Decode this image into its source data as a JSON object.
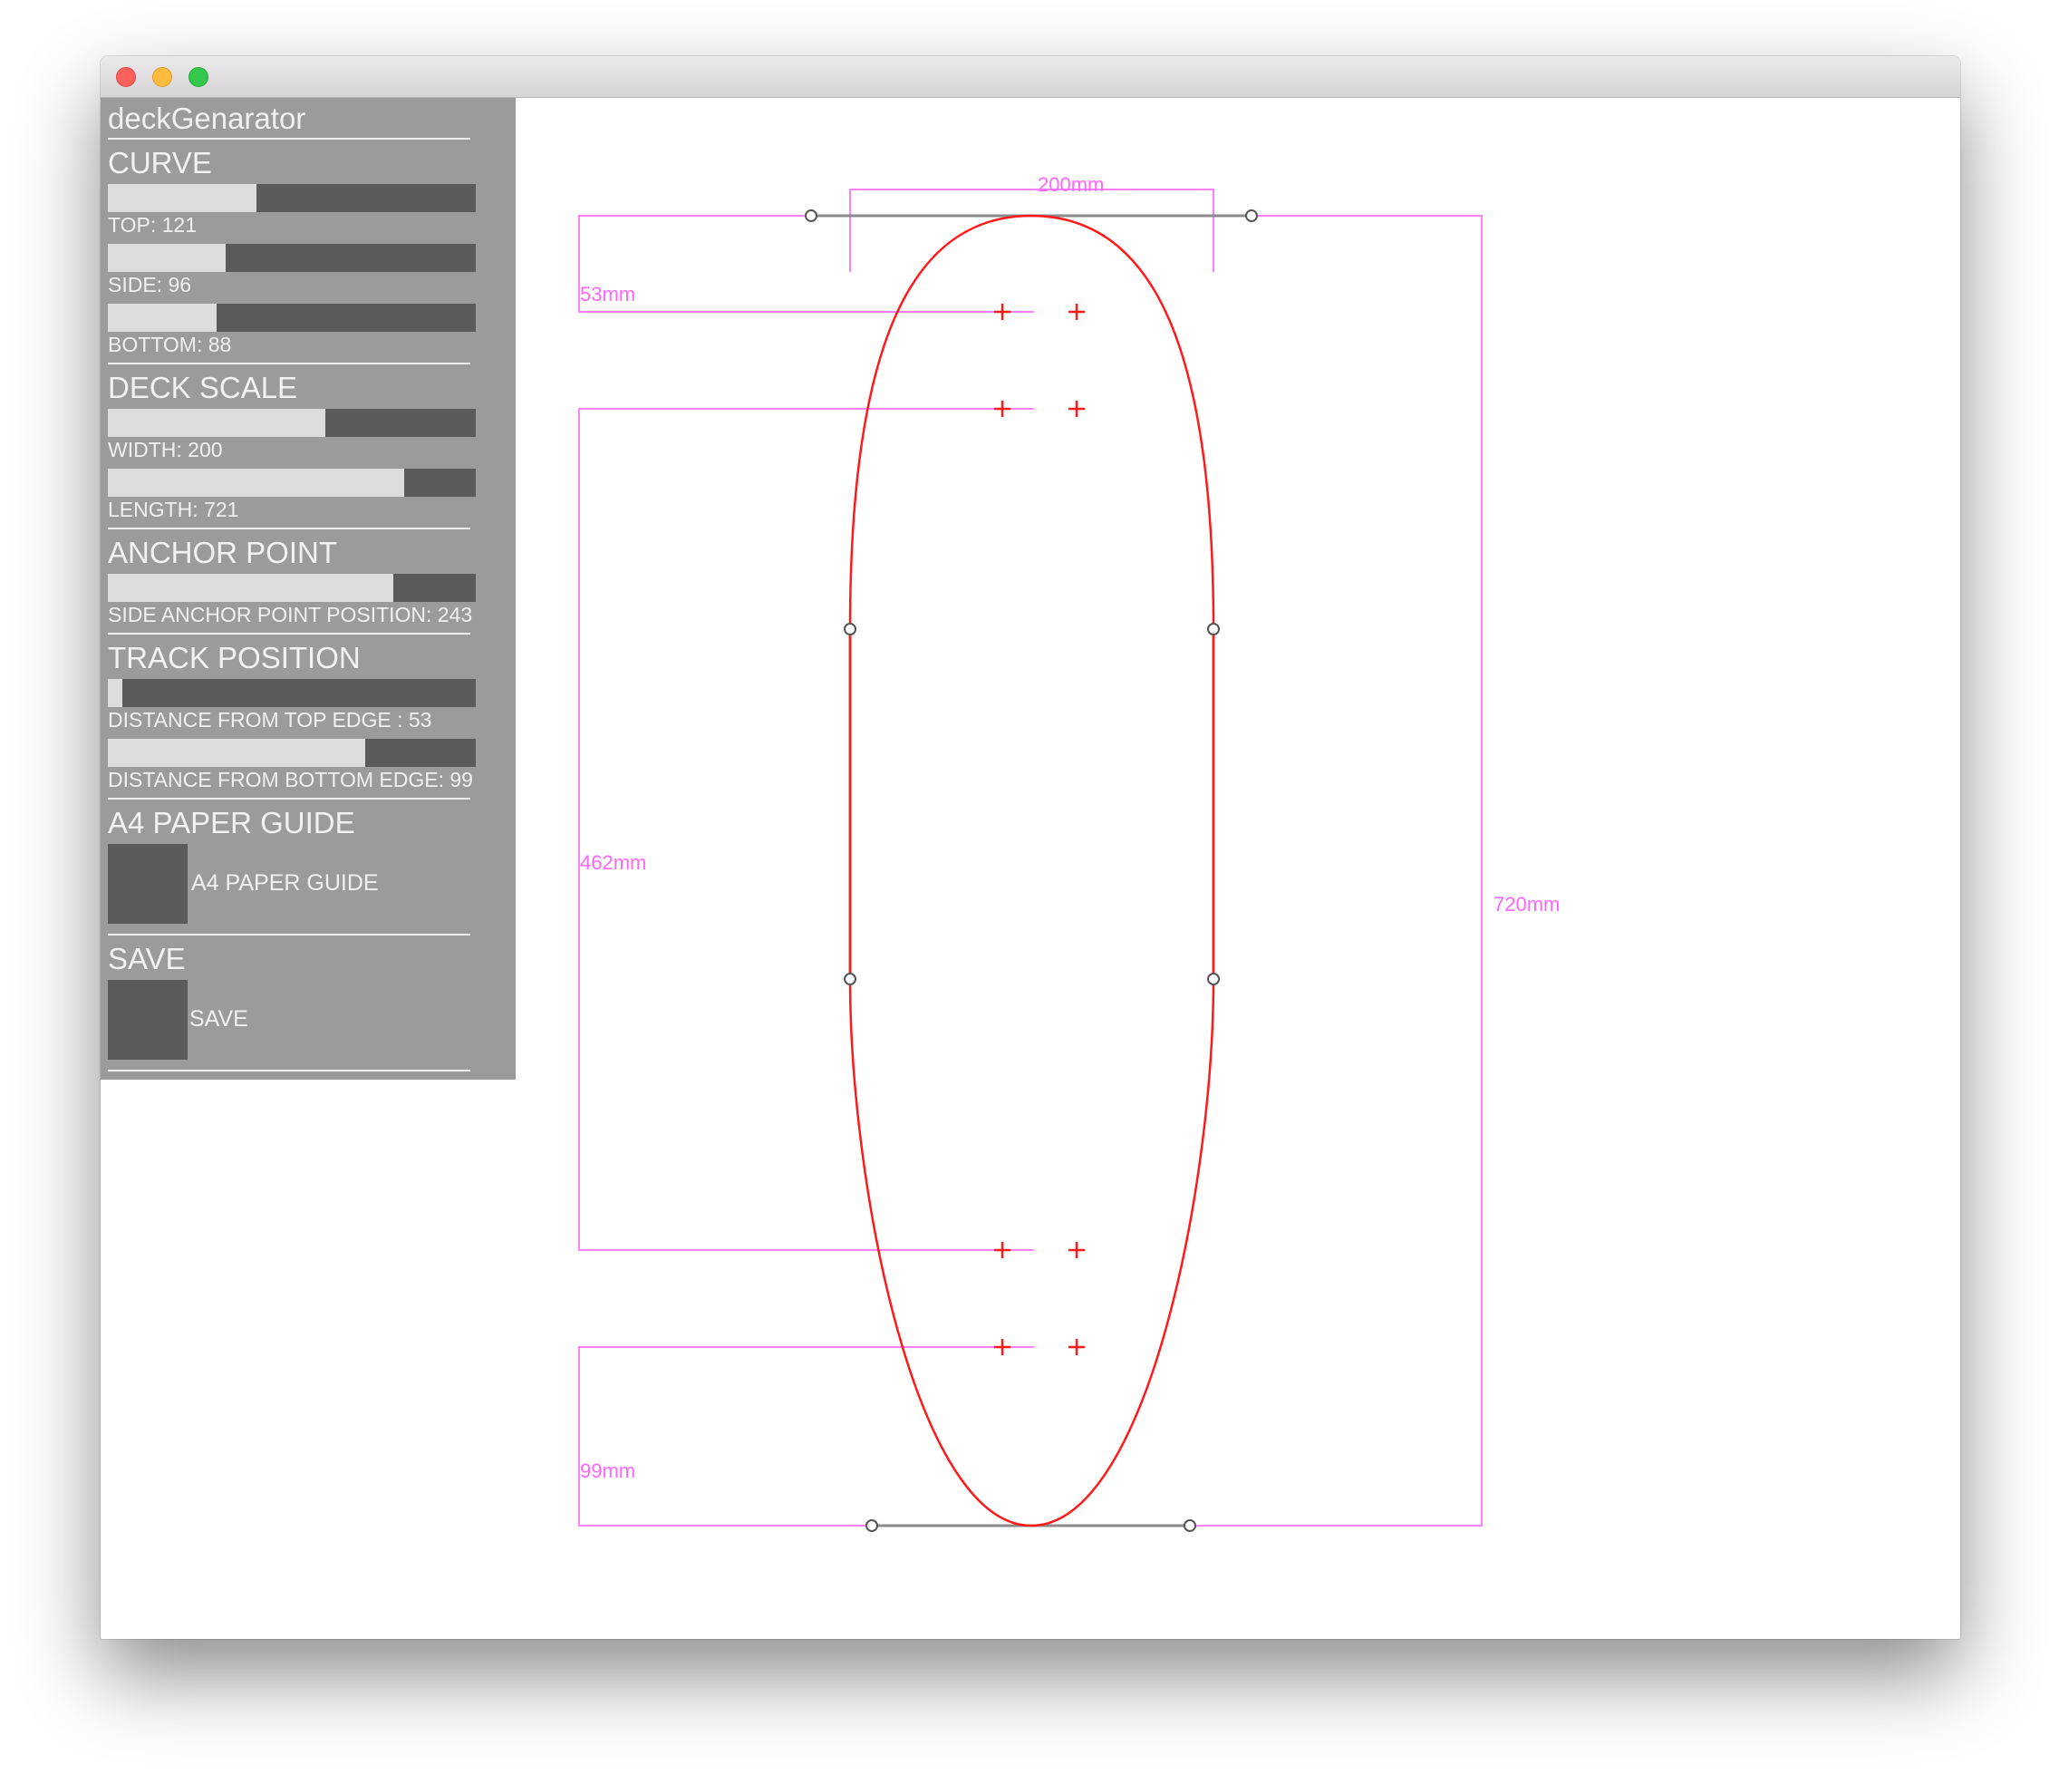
{
  "app": {
    "title": "deckGenarator"
  },
  "colors": {
    "guide": "#ff80ff",
    "deck_outline": "#ff1a1a",
    "handle": "#555555",
    "panel_bg": "#9b9b9b",
    "slider_track": "#5b5b5b",
    "slider_fill": "#dcdcdc"
  },
  "panel": {
    "curve": {
      "title": "CURVE",
      "top": {
        "label": "TOP: 121",
        "fraction": 0.405
      },
      "side": {
        "label": "SIDE: 96",
        "fraction": 0.32
      },
      "bottom": {
        "label": "BOTTOM: 88",
        "fraction": 0.295
      }
    },
    "deck_scale": {
      "title": "DECK SCALE",
      "width": {
        "label": "WIDTH: 200",
        "fraction": 0.59
      },
      "length": {
        "label": "LENGTH: 721",
        "fraction": 0.805
      }
    },
    "anchor_point": {
      "title": "ANCHOR POINT",
      "side": {
        "label": "SIDE ANCHOR POINT POSITION: 243",
        "fraction": 0.775
      }
    },
    "track_position": {
      "title": "TRACK POSITION",
      "from_top": {
        "label": "DISTANCE FROM TOP EDGE : 53",
        "fraction": 0.04
      },
      "from_bottom": {
        "label": "DISTANCE FROM BOTTOM EDGE: 99",
        "fraction": 0.7
      }
    },
    "a4_guide": {
      "title": "A4 PAPER GUIDE",
      "toggle_label": "A4 PAPER GUIDE",
      "enabled": false
    },
    "save": {
      "title": "SAVE",
      "button_label": "SAVE"
    }
  },
  "drawing": {
    "width_label": "200mm",
    "length_label": "720mm",
    "top_track_label": "53mm",
    "wheelbase_label": "462mm",
    "bottom_track_label": "99mm"
  }
}
